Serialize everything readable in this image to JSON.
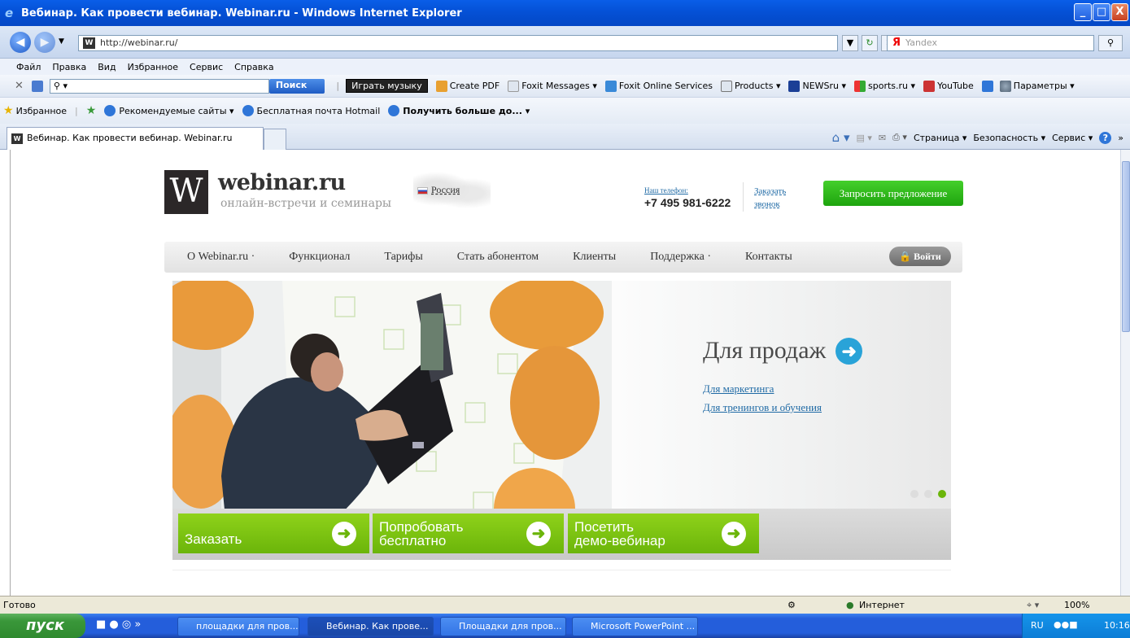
{
  "window": {
    "title": "Вебинар. Как провести вебинар. Webinar.ru - Windows Internet Explorer",
    "min_label": "_",
    "max_label": "□",
    "close_label": "X"
  },
  "addressbar": {
    "url": "http://webinar.ru/",
    "search_placeholder": "Yandex",
    "search_engine_glyph": "Я"
  },
  "menubar": {
    "items": [
      "Файл",
      "Правка",
      "Вид",
      "Избранное",
      "Сервис",
      "Справка"
    ]
  },
  "toolbar": {
    "search_button": "Поиск",
    "music_button": "Играть музыку",
    "items": [
      "Create PDF",
      "Foxit Messages ▾",
      "Foxit Online Services",
      "Products ▾",
      "NEWSru ▾",
      "sports.ru ▾",
      "YouTube",
      "Параметры ▾"
    ]
  },
  "favbar": {
    "favorites": "Избранное",
    "items": [
      "Рекомендуемые сайты ▾",
      "Бесплатная почта Hotmail",
      "Получить больше до... ▾"
    ]
  },
  "tabs": {
    "active_tab": "Вебинар. Как провести вебинар. Webinar.ru",
    "commands": [
      "Страница ▾",
      "Безопасность ▾",
      "Сервис ▾"
    ]
  },
  "site": {
    "logo_letter": "W",
    "logo_name": "webinar.ru",
    "logo_sub": "онлайн-встречи и семинары",
    "region": "Россия",
    "phone_label": "Наш телефон:",
    "phone_number": "+7 495 981-6222",
    "callback_line1": "Заказать",
    "callback_line2": "звонок",
    "request_button": "Запросить предложение",
    "nav": [
      "О Webinar.ru ·",
      "Функционал",
      "Тарифы",
      "Стать абонентом",
      "Клиенты",
      "Поддержка ·",
      "Контакты"
    ],
    "login": "Войти",
    "banner": {
      "title": "Для продаж",
      "link1": "Для маркетинга",
      "link2": "Для тренингов и обучения",
      "slides_total": 3,
      "active_slide": 3
    },
    "cta": [
      {
        "line1": "Заказать",
        "line2": ""
      },
      {
        "line1": "Попробовать",
        "line2": "бесплатно"
      },
      {
        "line1": "Посетить",
        "line2": "демо-вебинар"
      }
    ]
  },
  "statusbar": {
    "status": "Готово",
    "zone": "Интернет",
    "zoom": "100%"
  },
  "taskbar": {
    "start": "пуск",
    "tasks": [
      "площадки для пров...",
      "Вебинар. Как прове...",
      "Площадки для пров...",
      "Microsoft PowerPoint ..."
    ],
    "lang": "RU",
    "time": "10:16"
  },
  "colors": {
    "accent_green": "#6bb50a",
    "request_green": "#1ea40e",
    "link_blue": "#1f6aa5",
    "xp_blue": "#245edb"
  }
}
